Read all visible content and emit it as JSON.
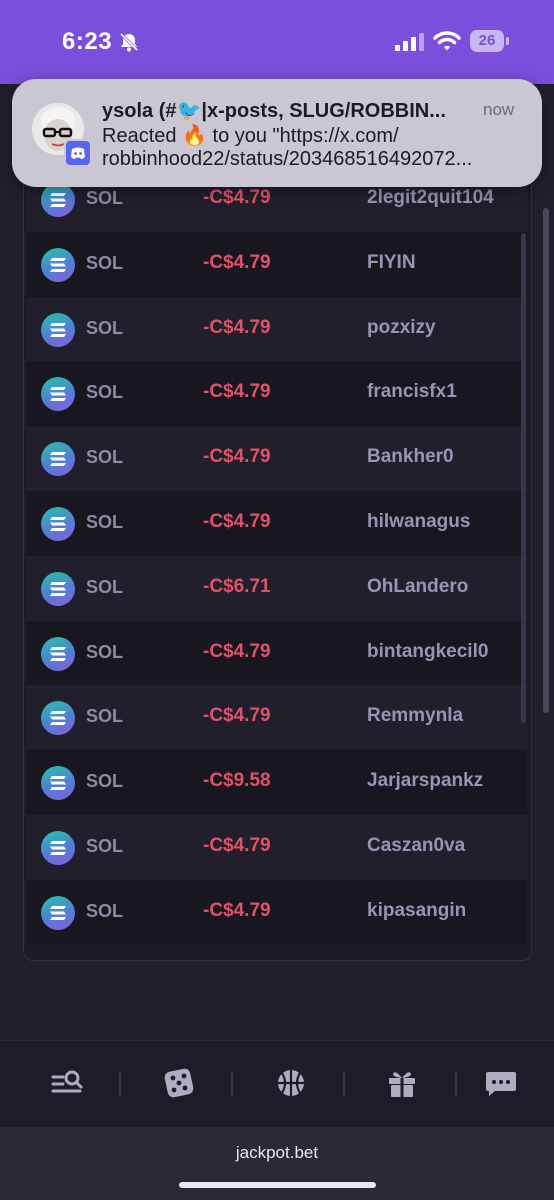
{
  "status_bar": {
    "time": "6:23",
    "battery": "26",
    "colors": {
      "background": "#7b4fdc"
    }
  },
  "notification": {
    "title": "ysola (#🐦|x-posts, SLUG/ROBBIN...",
    "time": "now",
    "body_line1": "Reacted 🔥 to you \"https://x.com/",
    "body_line2": "robbinhood22/status/203468516492072...",
    "app_icon": "discord-icon"
  },
  "transactions": [
    {
      "asset": "SOL",
      "amount": "-C$4.79",
      "user": "2legit2quit104"
    },
    {
      "asset": "SOL",
      "amount": "-C$4.79",
      "user": "FIYIN"
    },
    {
      "asset": "SOL",
      "amount": "-C$4.79",
      "user": "pozxizy"
    },
    {
      "asset": "SOL",
      "amount": "-C$4.79",
      "user": "francisfx1"
    },
    {
      "asset": "SOL",
      "amount": "-C$4.79",
      "user": "Bankher0"
    },
    {
      "asset": "SOL",
      "amount": "-C$4.79",
      "user": "hilwanagus"
    },
    {
      "asset": "SOL",
      "amount": "-C$6.71",
      "user": "OhLandero"
    },
    {
      "asset": "SOL",
      "amount": "-C$4.79",
      "user": "bintangkecil0"
    },
    {
      "asset": "SOL",
      "amount": "-C$4.79",
      "user": "Remmynla"
    },
    {
      "asset": "SOL",
      "amount": "-C$9.58",
      "user": "Jarjarspankz"
    },
    {
      "asset": "SOL",
      "amount": "-C$4.79",
      "user": "Caszan0va"
    },
    {
      "asset": "SOL",
      "amount": "-C$4.79",
      "user": "kipasangin"
    }
  ],
  "bottom_nav": [
    {
      "icon": "search-list-icon"
    },
    {
      "icon": "dice-icon"
    },
    {
      "icon": "basketball-icon"
    },
    {
      "icon": "gift-icon"
    },
    {
      "icon": "chat-icon"
    }
  ],
  "browser": {
    "domain": "jackpot.bet"
  },
  "colors": {
    "negative_amount": "#e0526a",
    "username": "#9a94b4",
    "accent": "#7b4fdc"
  }
}
